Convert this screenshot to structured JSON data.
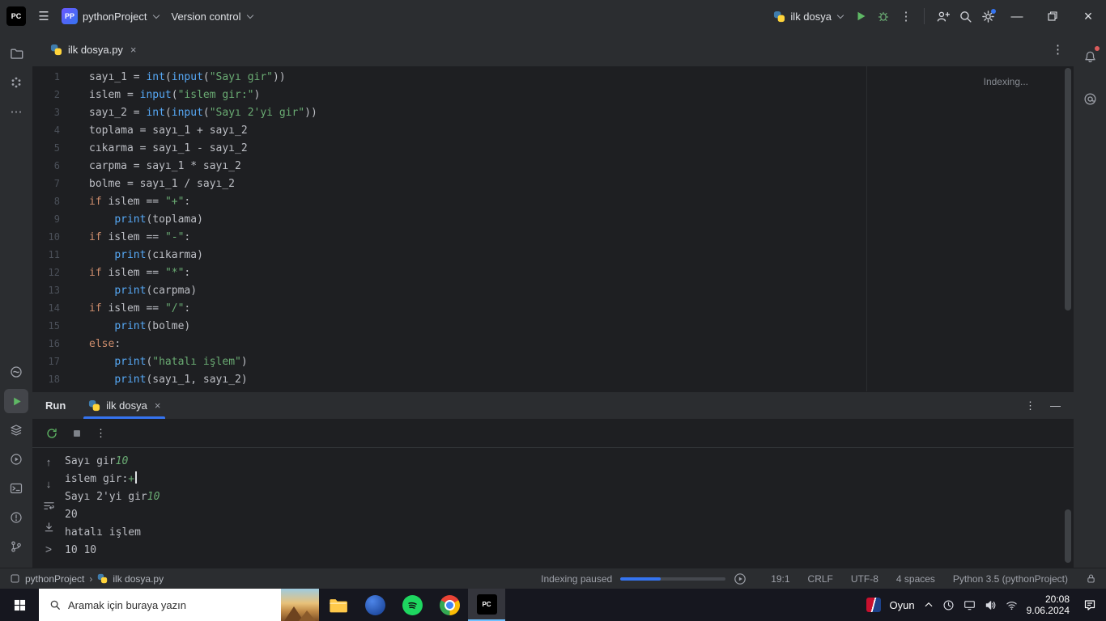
{
  "icons": {
    "pc_logo": "PC",
    "menu": "☰",
    "more_v": "⋮",
    "more_h": "⋯",
    "close": "×",
    "minimize": "—",
    "hide": "—",
    "up": "↑",
    "down": "↓",
    "prompt": ">",
    "breadcrumb_sep": "›"
  },
  "titlebar": {
    "project_badge": "PP",
    "project_name": "pythonProject",
    "vcs_label": "Version control",
    "run_config": "ilk dosya"
  },
  "tabbar": {
    "active_tab": "ilk dosya.py"
  },
  "editor": {
    "indexing_label": "Indexing...",
    "lines": [
      {
        "tokens": [
          [
            "d",
            "sayı_1 = "
          ],
          [
            "b",
            "int"
          ],
          [
            "d",
            "("
          ],
          [
            "b",
            "input"
          ],
          [
            "d",
            "("
          ],
          [
            "s",
            "\"Sayı gir\""
          ],
          [
            "d",
            "))"
          ]
        ]
      },
      {
        "tokens": [
          [
            "d",
            "islem = "
          ],
          [
            "b",
            "input"
          ],
          [
            "d",
            "("
          ],
          [
            "s",
            "\"islem gir:\""
          ],
          [
            "d",
            ")"
          ]
        ]
      },
      {
        "tokens": [
          [
            "d",
            "sayı_2 = "
          ],
          [
            "b",
            "int"
          ],
          [
            "d",
            "("
          ],
          [
            "b",
            "input"
          ],
          [
            "d",
            "("
          ],
          [
            "s",
            "\"Sayı 2'yi gir\""
          ],
          [
            "d",
            "))"
          ]
        ]
      },
      {
        "tokens": [
          [
            "d",
            "toplama = sayı_1 + sayı_2"
          ]
        ]
      },
      {
        "tokens": [
          [
            "d",
            "cıkarma = sayı_1 - sayı_2"
          ]
        ]
      },
      {
        "tokens": [
          [
            "d",
            "carpma = sayı_1 * sayı_2"
          ]
        ]
      },
      {
        "tokens": [
          [
            "d",
            "bolme = sayı_1 / sayı_2"
          ]
        ]
      },
      {
        "tokens": [
          [
            "k",
            "if"
          ],
          [
            "d",
            " islem == "
          ],
          [
            "s",
            "\"+\""
          ],
          [
            "d",
            ":"
          ]
        ]
      },
      {
        "tokens": [
          [
            "d",
            "    "
          ],
          [
            "b",
            "print"
          ],
          [
            "d",
            "(toplama)"
          ]
        ]
      },
      {
        "tokens": [
          [
            "k",
            "if"
          ],
          [
            "d",
            " islem == "
          ],
          [
            "s",
            "\"-\""
          ],
          [
            "d",
            ":"
          ]
        ]
      },
      {
        "tokens": [
          [
            "d",
            "    "
          ],
          [
            "b",
            "print"
          ],
          [
            "d",
            "(cıkarma)"
          ]
        ]
      },
      {
        "tokens": [
          [
            "k",
            "if"
          ],
          [
            "d",
            " islem == "
          ],
          [
            "s",
            "\"*\""
          ],
          [
            "d",
            ":"
          ]
        ]
      },
      {
        "tokens": [
          [
            "d",
            "    "
          ],
          [
            "b",
            "print"
          ],
          [
            "d",
            "(carpma)"
          ]
        ]
      },
      {
        "tokens": [
          [
            "k",
            "if"
          ],
          [
            "d",
            " islem == "
          ],
          [
            "s",
            "\"/\""
          ],
          [
            "d",
            ":"
          ]
        ]
      },
      {
        "tokens": [
          [
            "d",
            "    "
          ],
          [
            "b",
            "print"
          ],
          [
            "d",
            "(bolme)"
          ]
        ]
      },
      {
        "tokens": [
          [
            "k",
            "else"
          ],
          [
            "d",
            ":"
          ]
        ]
      },
      {
        "tokens": [
          [
            "d",
            "    "
          ],
          [
            "b",
            "print"
          ],
          [
            "d",
            "("
          ],
          [
            "s",
            "\"hatalı işlem\""
          ],
          [
            "d",
            ")"
          ]
        ]
      },
      {
        "tokens": [
          [
            "d",
            "    "
          ],
          [
            "b",
            "print"
          ],
          [
            "d",
            "(sayı_1, sayı_2)"
          ]
        ]
      }
    ]
  },
  "run_panel": {
    "title": "Run",
    "tab_label": "ilk dosya",
    "console_lines": [
      {
        "parts": [
          [
            "o",
            "Sayı gir"
          ],
          [
            "i",
            "10"
          ]
        ]
      },
      {
        "parts": [
          [
            "o",
            "islem gir:"
          ],
          [
            "i",
            "+"
          ]
        ],
        "cursor": true
      },
      {
        "parts": [
          [
            "o",
            "Sayı 2'yi gir"
          ],
          [
            "i",
            "10"
          ]
        ]
      },
      {
        "parts": [
          [
            "o",
            "20"
          ]
        ]
      },
      {
        "parts": [
          [
            "o",
            "hatalı işlem"
          ]
        ]
      },
      {
        "parts": [
          [
            "o",
            "10 10"
          ]
        ]
      }
    ]
  },
  "statusbar": {
    "breadcrumb_project": "pythonProject",
    "breadcrumb_file": "ilk dosya.py",
    "indexing_label": "Indexing paused",
    "progress_percent": 38,
    "caret_position": "19:1",
    "line_separator": "CRLF",
    "encoding": "UTF-8",
    "indent": "4 spaces",
    "interpreter": "Python 3.5 (pythonProject)"
  },
  "taskbar": {
    "search_placeholder": "Aramak için buraya yazın",
    "game_label": "Oyun",
    "clock_time": "20:08",
    "clock_date": "9.06.2024"
  },
  "colors": {
    "accent": "#3574f0",
    "keyword": "#cf8e6d",
    "builtin": "#56a8f5",
    "string": "#6aab73",
    "console_input": "#6aab73",
    "run_green": "#5fb865",
    "titlebar_bg": "#2b2d30",
    "editor_bg": "#1e1f22"
  }
}
